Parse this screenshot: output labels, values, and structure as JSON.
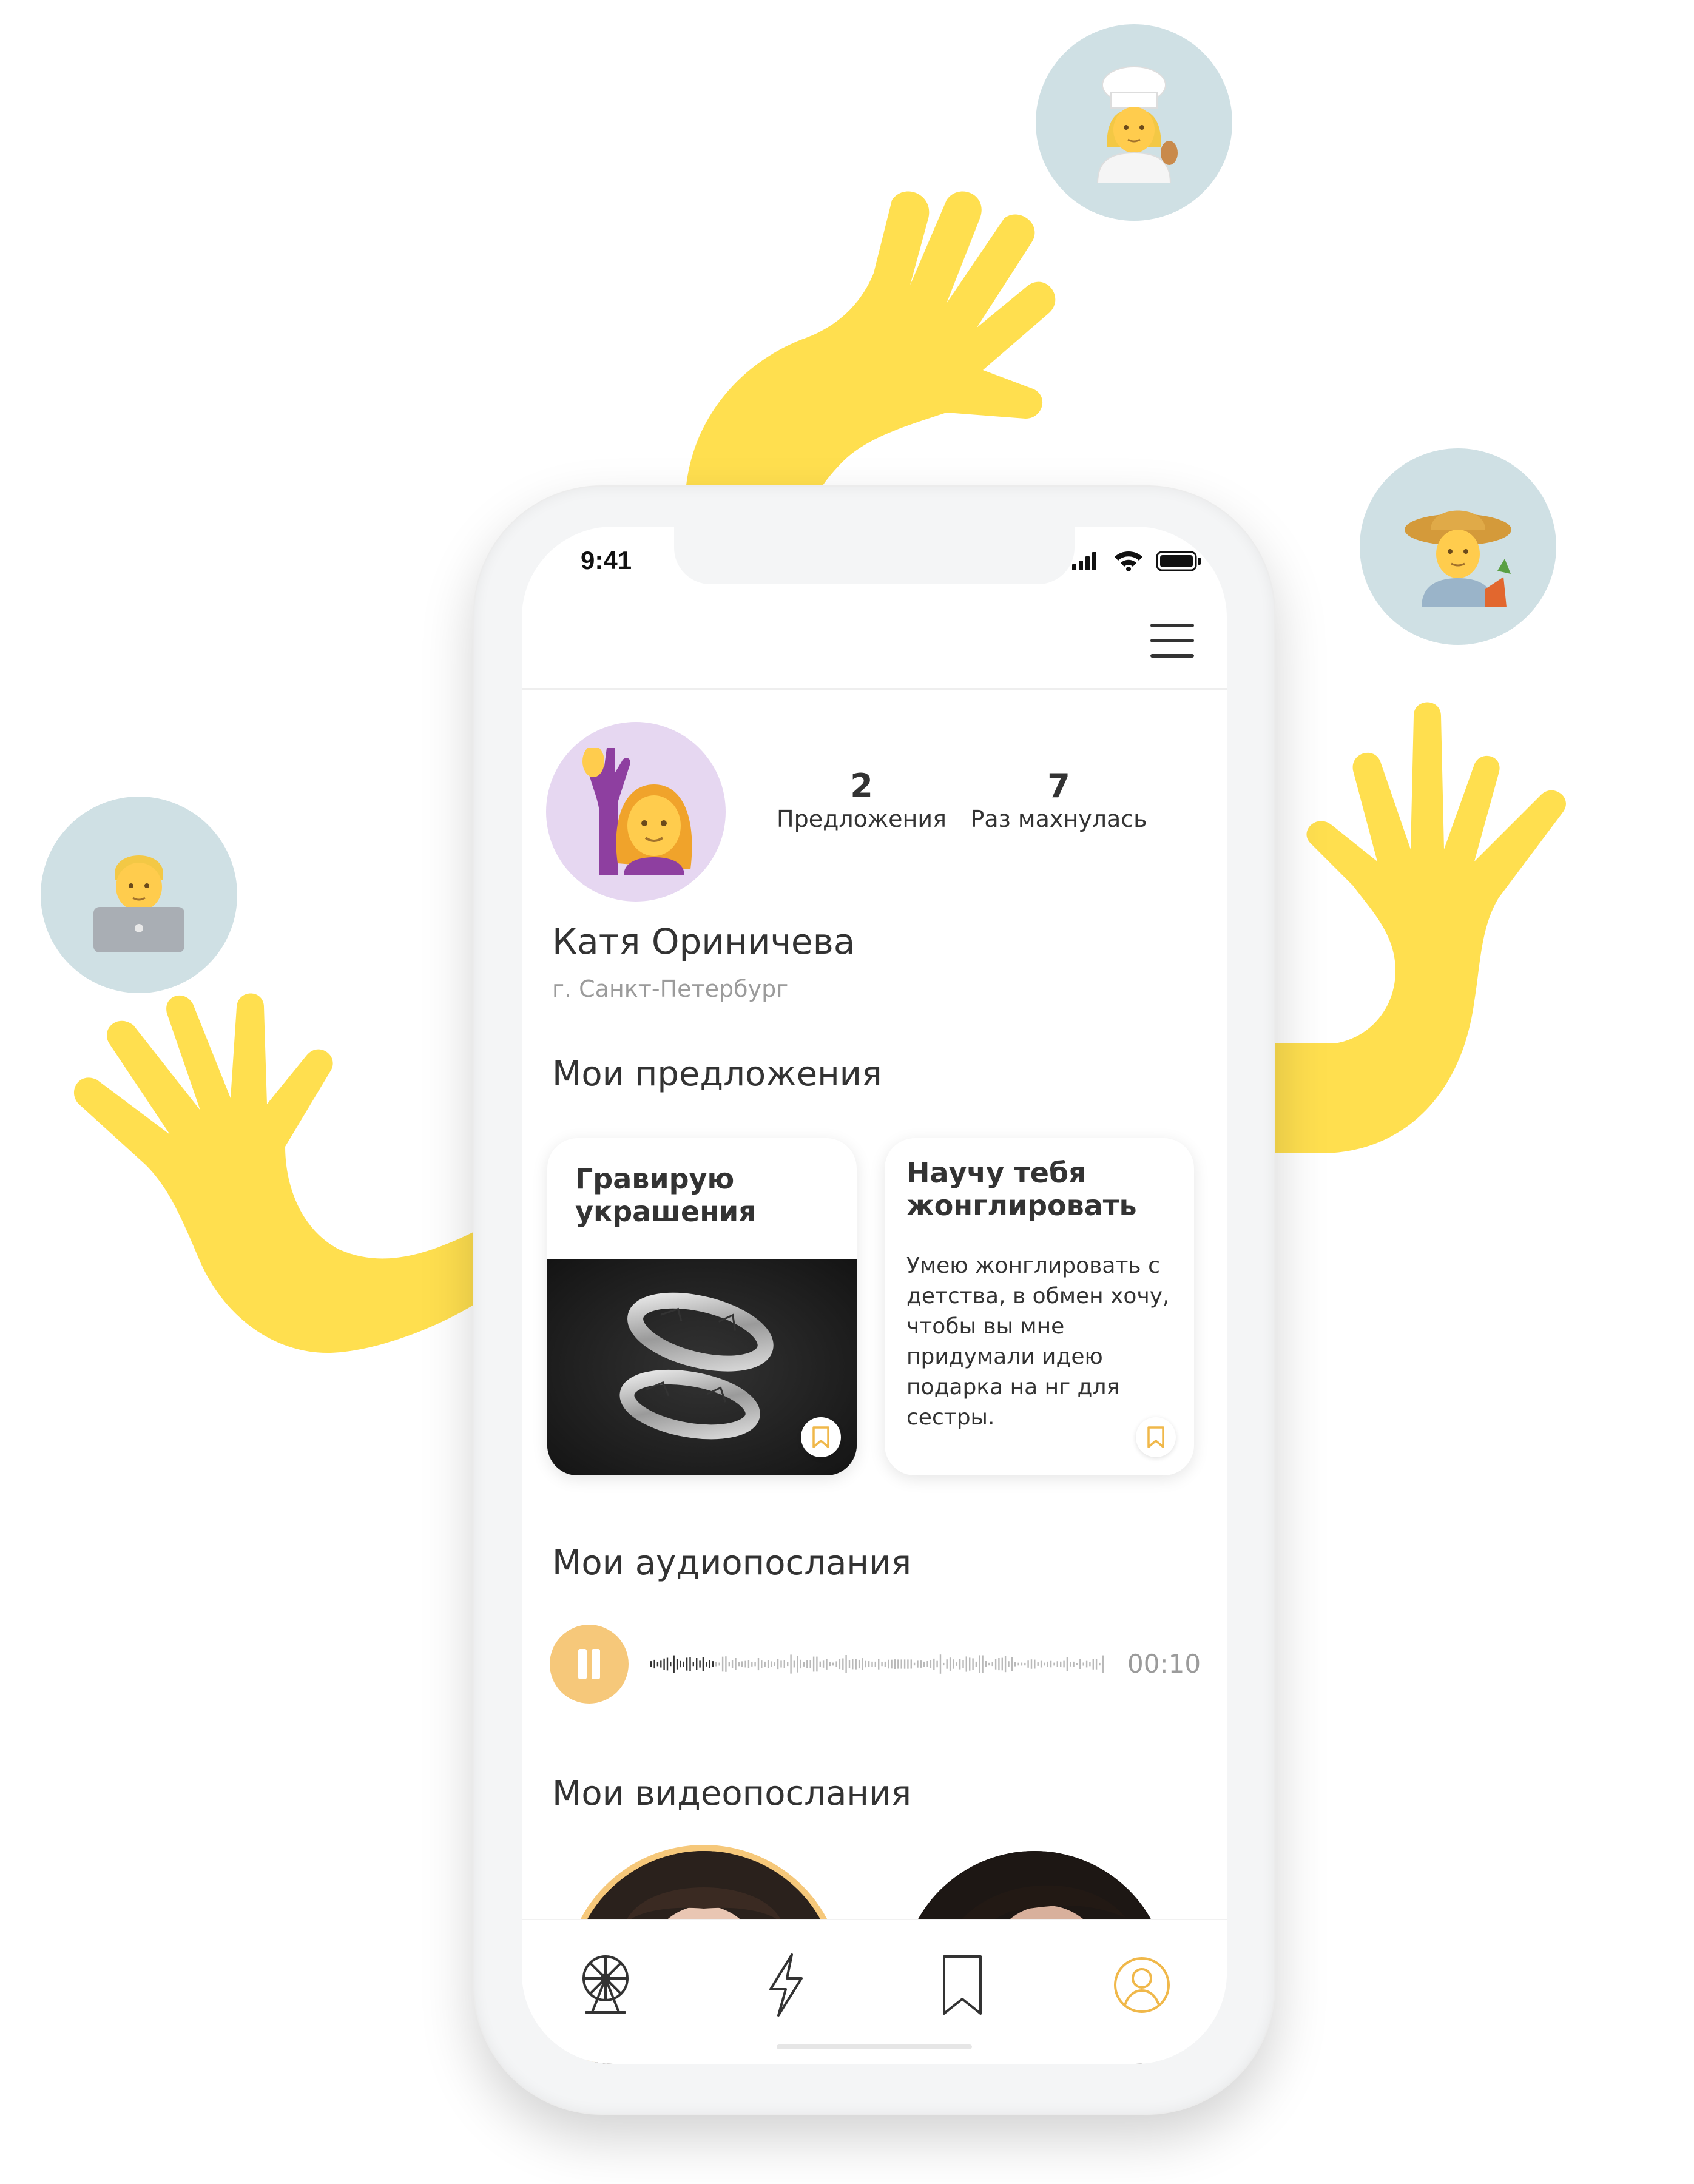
{
  "colors": {
    "accent_yellow": "#ffdf4f",
    "accent_orange": "#f6c87a",
    "bubble_blue": "#cfe0e4",
    "avatar_lilac": "#e6d7f1",
    "text_dark": "#333333",
    "text_muted": "#9b9b9b"
  },
  "status_bar": {
    "time": "9:41",
    "icons": [
      "signal-icon",
      "wifi-icon",
      "battery-icon"
    ]
  },
  "header": {
    "menu_icon": "hamburger-menu-icon"
  },
  "profile": {
    "avatar_icon": "woman-raising-hand-emoji",
    "stats": [
      {
        "value": "2",
        "label": "Предложения"
      },
      {
        "value": "7",
        "label": "Раз махнулась"
      }
    ],
    "name": "Катя Ориничева",
    "city": "г. Санкт-Петербург"
  },
  "offers": {
    "title": "Мои предложения",
    "cards": [
      {
        "title_line1": "Гравирую",
        "title_line2": "украшения",
        "image_icon": "engraved-rings-photo",
        "save_icon": "bookmark-icon"
      },
      {
        "title_line1": "Научу тебя",
        "title_line2": "жонглировать",
        "description": "Умею жонглировать с детства, в обмен хочу, чтобы вы мне придумали идею подарка на нг для сестры.",
        "save_icon": "bookmark-icon"
      }
    ]
  },
  "audio": {
    "title": "Мои аудиопослания",
    "play_icon": "pause-icon",
    "duration": "00:10",
    "progress": 0.14
  },
  "video": {
    "title": "Мои видеопослания",
    "thumbnails": [
      "video-thumbnail-woman-1",
      "video-thumbnail-woman-2"
    ]
  },
  "tabbar": {
    "items": [
      "ferris-wheel-icon",
      "lightning-icon",
      "bookmark-icon",
      "profile-icon"
    ],
    "active_index": 3
  },
  "decorations": {
    "bubbles": [
      "chef-woman-emoji",
      "farmer-man-emoji",
      "technologist-man-emoji"
    ]
  }
}
